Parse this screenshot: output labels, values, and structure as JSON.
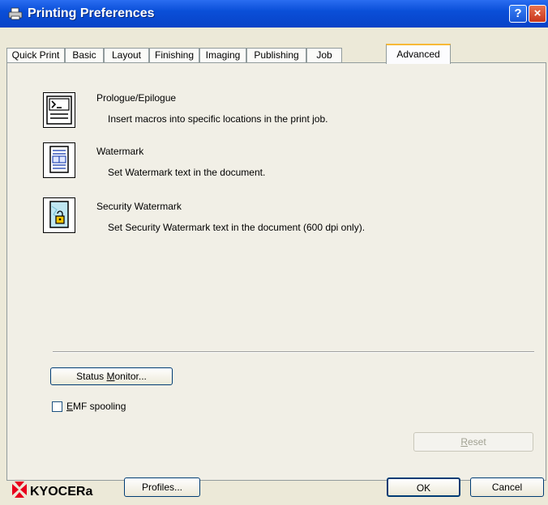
{
  "window": {
    "title": "Printing Preferences",
    "help_label": "?",
    "close_label": "×"
  },
  "tabs": [
    {
      "label": "Quick Print"
    },
    {
      "label": "Basic"
    },
    {
      "label": "Layout"
    },
    {
      "label": "Finishing"
    },
    {
      "label": "Imaging"
    },
    {
      "label": "Publishing"
    },
    {
      "label": "Job"
    },
    {
      "label": "Advanced",
      "active": true
    }
  ],
  "features": [
    {
      "title": "Prologue/Epilogue",
      "description": "Insert macros into specific locations in the print job.",
      "icon": "prologue-epilogue-icon"
    },
    {
      "title": "Watermark",
      "description": "Set Watermark text in the document.",
      "icon": "watermark-icon"
    },
    {
      "title": "Security Watermark",
      "description": "Set Security Watermark text in the document (600 dpi only).",
      "icon": "security-watermark-icon"
    }
  ],
  "status_monitor": {
    "pre": "Status ",
    "key": "M",
    "post": "onitor..."
  },
  "emf": {
    "key": "E",
    "rest": "MF spooling",
    "checked": false
  },
  "reset": {
    "key": "R",
    "rest": "eset",
    "enabled": false
  },
  "footer": {
    "brand": "KYOCERa",
    "profiles_label": "Profiles...",
    "ok_label": "OK",
    "cancel_label": "Cancel"
  },
  "colors": {
    "title_bar": "#0a4fd8",
    "brand_red": "#e8001c",
    "active_tab_accent": "#f7b937"
  }
}
